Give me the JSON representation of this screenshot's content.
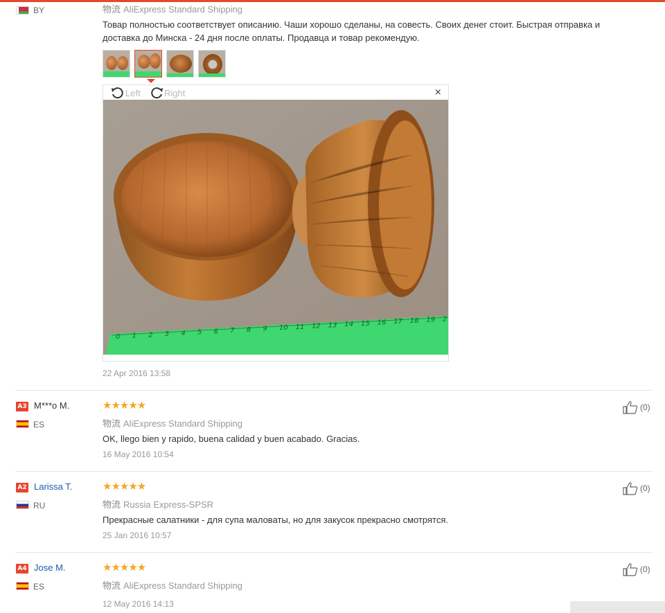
{
  "reviews": [
    {
      "country": "BY",
      "shipping_cn": "物流",
      "shipping": "AliExpress Standard Shipping",
      "text": "Товар полностью соответствует описанию. Чаши хорошо сделаны, на совесть. Своих денег стоит. Быстрая отправка и доставка до Минска - 24 дня после оплаты. Продавца и товар рекомендую.",
      "date": "22 Apr 2016 13:58",
      "viewer": {
        "left_label": "Left",
        "right_label": "Right",
        "close": "×"
      }
    },
    {
      "level": "A3",
      "name": "M***o M.",
      "country": "ES",
      "stars": "★★★★★",
      "rating": 5,
      "shipping_cn": "物流",
      "shipping": "AliExpress Standard Shipping",
      "text": "OK, llego bien y rapido, buena calidad y buen acabado. Gracias.",
      "date": "16 May 2016 10:54",
      "helpful": "(0)"
    },
    {
      "level": "A2",
      "name": "Larissa T.",
      "country": "RU",
      "stars": "★★★★★",
      "rating": 5,
      "shipping_cn": "物流",
      "shipping": "Russia Express-SPSR",
      "text": "Прекрасные салатники - для супа маловаты, но для закусок прекрасно смотрятся.",
      "date": "25 Jan 2016 10:57",
      "helpful": "(0)"
    },
    {
      "level": "A4",
      "name": "Jose M.",
      "country": "ES",
      "stars": "★★★★★",
      "rating": 5,
      "shipping_cn": "物流",
      "shipping": "AliExpress Standard Shipping",
      "date": "12 May 2016 14:13",
      "helpful": "(0)"
    }
  ],
  "photo": {
    "ruler_numbers": [
      "0",
      "1",
      "2",
      "3",
      "4",
      "5",
      "6",
      "7",
      "8",
      "9",
      "10",
      "11",
      "12",
      "13",
      "14",
      "15",
      "16",
      "17",
      "18",
      "19",
      "2"
    ]
  },
  "colors": {
    "accent": "#e8442c",
    "star": "#f5a623",
    "link": "#1a5ca8",
    "ruler": "#3fd76f"
  }
}
